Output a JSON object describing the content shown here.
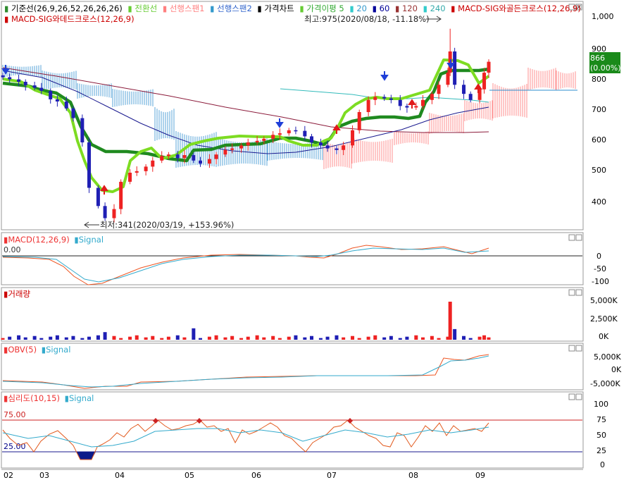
{
  "legend_main": [
    {
      "marker": "▮",
      "label": "기준선(26,9,26,52,26,26,26)",
      "marker_color": "#2e8b2e",
      "text_color": "#000000"
    },
    {
      "marker": "▮",
      "label": "전환선",
      "marker_color": "#66cc33",
      "text_color": "#66cc33"
    },
    {
      "marker": "▮",
      "label": "선행스팬1",
      "marker_color": "#ff8080",
      "text_color": "#ff8080"
    },
    {
      "marker": "▮",
      "label": "선행스팬2",
      "marker_color": "#3399cc",
      "text_color": "#3366cc"
    },
    {
      "marker": "▮",
      "label": "가격차트",
      "marker_color": "#000000",
      "text_color": "#000000"
    },
    {
      "marker": "▮",
      "label": "가격이평 5",
      "marker_color": "#66cc33",
      "text_color": "#33aa33"
    },
    {
      "marker": "▮",
      "label": "20",
      "marker_color": "#33cccc",
      "text_color": "#3399cc"
    },
    {
      "marker": "▮",
      "label": "60",
      "marker_color": "#000099",
      "text_color": "#000099"
    },
    {
      "marker": "▮",
      "label": "120",
      "marker_color": "#993333",
      "text_color": "#993333"
    },
    {
      "marker": "▮",
      "label": "240",
      "marker_color": "#33cccc",
      "text_color": "#33aaaa"
    },
    {
      "marker": "▮",
      "label": "MACD-SIG와골든크로스(12,26,9)",
      "marker_color": "#cc0000",
      "text_color": "#cc0000"
    }
  ],
  "legend_main_line2": {
    "marker": "▮",
    "label": "MACD-SIG와데드크로스(12,26,9)",
    "marker_color": "#cc0000",
    "text_color": "#cc0000"
  },
  "annotations": {
    "high": "최고:975(2020/08/18, -11.18%)",
    "low": "최저:341(2020/03/19, +153.96%)"
  },
  "price_badge": {
    "price": "866",
    "change": "(0.00%)"
  },
  "panels": {
    "macd": {
      "title": "MACD(12,26,9)",
      "signal": "Signal",
      "zero_label": "0.00",
      "ticks": [
        "0",
        "-50",
        "-100"
      ]
    },
    "volume": {
      "title": "거래량",
      "ticks": [
        "5,000K",
        "2,500K",
        "0K"
      ]
    },
    "obv": {
      "title": "OBV(5)",
      "signal": "Signal",
      "ticks": [
        "5,000K",
        "0K",
        "-5,000K"
      ]
    },
    "psych": {
      "title": "심리도(10,15)",
      "signal": "Signal",
      "level_high": "75.00",
      "level_low": "25.00",
      "ticks": [
        "100",
        "75",
        "50",
        "25",
        "0"
      ]
    }
  },
  "x_months": [
    "02",
    "03",
    "04",
    "05",
    "06",
    "07",
    "08",
    "09"
  ],
  "colors": {
    "up": "#ee2222",
    "down": "#1f1fb4",
    "kijun": "#1f8a1f",
    "tenkan": "#7ddc22",
    "span1": "#ff7373",
    "span2": "#2f8fcf",
    "ma20": "#33bbbb",
    "ma60": "#1a1a8f",
    "ma120": "#8b1a3a",
    "panel_border": "#9a9a9a",
    "grid": "#000000"
  },
  "chart_data": [
    {
      "type": "candlestick",
      "title": "가격차트",
      "x_axis": "date (2020)",
      "xlim": [
        "2020-02-01",
        "2020-09-30"
      ],
      "ylim": [
        310,
        1030
      ],
      "y_ticks": [
        1000,
        900,
        800,
        700,
        600,
        500,
        400
      ],
      "last_close": 866,
      "high": {
        "date": "2020-08-18",
        "value": 975
      },
      "low": {
        "date": "2020-03-19",
        "value": 341
      },
      "series": [
        {
          "name": "가격차트",
          "points": [
            [
              "2020-02-03",
              815
            ],
            [
              "2020-02-06",
              808
            ],
            [
              "2020-02-10",
              800
            ],
            [
              "2020-02-13",
              788
            ],
            [
              "2020-02-17",
              780
            ],
            [
              "2020-02-20",
              770
            ],
            [
              "2020-02-24",
              742
            ],
            [
              "2020-02-27",
              735
            ],
            [
              "2020-03-02",
              712
            ],
            [
              "2020-03-05",
              680
            ],
            [
              "2020-03-09",
              600
            ],
            [
              "2020-03-12",
              450
            ],
            [
              "2020-03-16",
              390
            ],
            [
              "2020-03-19",
              350
            ],
            [
              "2020-03-23",
              380
            ],
            [
              "2020-03-26",
              470
            ],
            [
              "2020-03-30",
              500
            ],
            [
              "2020-04-02",
              505
            ],
            [
              "2020-04-06",
              520
            ],
            [
              "2020-04-09",
              540
            ],
            [
              "2020-04-13",
              555
            ],
            [
              "2020-04-16",
              560
            ],
            [
              "2020-04-20",
              548
            ],
            [
              "2020-04-23",
              558
            ],
            [
              "2020-04-27",
              540
            ],
            [
              "2020-04-30",
              530
            ],
            [
              "2020-05-04",
              545
            ],
            [
              "2020-05-07",
              560
            ],
            [
              "2020-05-11",
              575
            ],
            [
              "2020-05-14",
              580
            ],
            [
              "2020-05-18",
              590
            ],
            [
              "2020-05-21",
              600
            ],
            [
              "2020-05-25",
              605
            ],
            [
              "2020-05-28",
              612
            ],
            [
              "2020-06-01",
              625
            ],
            [
              "2020-06-04",
              630
            ],
            [
              "2020-06-08",
              640
            ],
            [
              "2020-06-11",
              638
            ],
            [
              "2020-06-15",
              620
            ],
            [
              "2020-06-18",
              600
            ],
            [
              "2020-06-22",
              590
            ],
            [
              "2020-06-25",
              580
            ],
            [
              "2020-06-29",
              575
            ],
            [
              "2020-07-02",
              590
            ],
            [
              "2020-07-06",
              640
            ],
            [
              "2020-07-09",
              700
            ],
            [
              "2020-07-13",
              740
            ],
            [
              "2020-07-16",
              750
            ],
            [
              "2020-07-20",
              745
            ],
            [
              "2020-07-23",
              740
            ],
            [
              "2020-07-27",
              720
            ],
            [
              "2020-07-30",
              715
            ],
            [
              "2020-08-03",
              720
            ],
            [
              "2020-08-06",
              740
            ],
            [
              "2020-08-10",
              760
            ],
            [
              "2020-08-13",
              790
            ],
            [
              "2020-08-17",
              830
            ],
            [
              "2020-08-18",
              900
            ],
            [
              "2020-08-20",
              790
            ],
            [
              "2020-08-24",
              760
            ],
            [
              "2020-08-27",
              740
            ],
            [
              "2020-08-31",
              775
            ],
            [
              "2020-09-02",
              830
            ],
            [
              "2020-09-04",
              866
            ]
          ]
        }
      ],
      "indicators": {
        "kijun": [
          [
            "2020-02-03",
            805
          ],
          [
            "2020-03-02",
            780
          ],
          [
            "2020-03-23",
            640
          ],
          [
            "2020-04-13",
            600
          ],
          [
            "2020-05-07",
            545
          ],
          [
            "2020-06-01",
            595
          ],
          [
            "2020-06-29",
            600
          ],
          [
            "2020-07-20",
            665
          ],
          [
            "2020-08-10",
            695
          ],
          [
            "2020-08-18",
            830
          ],
          [
            "2020-09-04",
            830
          ]
        ],
        "tenkan": [
          [
            "2020-02-03",
            800
          ],
          [
            "2020-03-02",
            740
          ],
          [
            "2020-03-19",
            430
          ],
          [
            "2020-04-06",
            520
          ],
          [
            "2020-04-27",
            565
          ],
          [
            "2020-05-25",
            600
          ],
          [
            "2020-06-22",
            590
          ],
          [
            "2020-07-13",
            715
          ],
          [
            "2020-08-03",
            740
          ],
          [
            "2020-08-18",
            845
          ],
          [
            "2020-08-27",
            780
          ],
          [
            "2020-09-04",
            800
          ]
        ]
      }
    },
    {
      "type": "line",
      "title": "MACD(12,26,9)",
      "ylim": [
        -110,
        40
      ],
      "series_names": [
        "MACD(12,26,9)",
        "Signal"
      ],
      "values_macd": [
        [
          "2020-02-03",
          -2
        ],
        [
          "2020-03-02",
          -10
        ],
        [
          "2020-03-16",
          -70
        ],
        [
          "2020-03-30",
          -100
        ],
        [
          "2020-04-27",
          -40
        ],
        [
          "2020-05-25",
          -5
        ],
        [
          "2020-06-29",
          -10
        ],
        [
          "2020-07-30",
          25
        ],
        [
          "2020-08-18",
          20
        ],
        [
          "2020-09-04",
          20
        ]
      ],
      "values_signal": [
        [
          "2020-02-03",
          -3
        ],
        [
          "2020-03-09",
          -20
        ],
        [
          "2020-04-06",
          -95
        ],
        [
          "2020-05-04",
          -40
        ],
        [
          "2020-06-08",
          -3
        ],
        [
          "2020-07-13",
          10
        ],
        [
          "2020-08-10",
          20
        ],
        [
          "2020-09-04",
          15
        ]
      ]
    },
    {
      "type": "bar",
      "title": "거래량",
      "ylim": [
        0,
        5500
      ],
      "unit": "K",
      "notable": [
        [
          "2020-08-18",
          5000
        ],
        [
          "2020-08-20",
          1400
        ],
        [
          "2020-04-27",
          1500
        ],
        [
          "2020-03-19",
          1000
        ]
      ]
    },
    {
      "type": "line",
      "title": "OBV(5)",
      "ylim": [
        -6000,
        6500
      ],
      "unit": "K",
      "series_names": [
        "OBV(5)",
        "Signal"
      ],
      "values": [
        [
          "2020-02-03",
          -2000
        ],
        [
          "2020-03-19",
          -5000
        ],
        [
          "2020-04-27",
          -4000
        ],
        [
          "2020-06-01",
          -2000
        ],
        [
          "2020-07-30",
          -1000
        ],
        [
          "2020-08-17",
          -1500
        ],
        [
          "2020-08-18",
          3000
        ],
        [
          "2020-09-04",
          5000
        ]
      ]
    },
    {
      "type": "line",
      "title": "심리도(10,15)",
      "ylim": [
        0,
        110
      ],
      "levels": [
        75,
        25
      ],
      "series_names": [
        "심리도(10,15)",
        "Signal"
      ]
    }
  ]
}
